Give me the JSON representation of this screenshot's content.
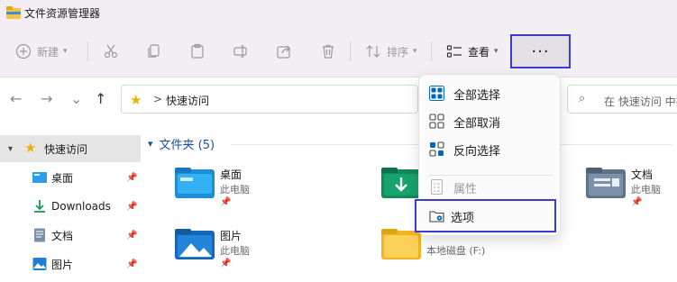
{
  "window": {
    "title": "文件资源管理器"
  },
  "toolbar": {
    "new_label": "新建",
    "sort_label": "排序",
    "view_label": "查看",
    "more_label": "···",
    "icons": {
      "new": "plus-circle-icon",
      "cut": "scissors-icon",
      "copy": "copy-icon",
      "paste": "clipboard-icon",
      "rename": "rename-icon",
      "share": "share-icon",
      "delete": "trash-icon",
      "sort": "sort-arrows-icon",
      "view": "view-list-icon"
    }
  },
  "address": {
    "crumb": "快速访问",
    "separator": ">"
  },
  "search": {
    "placeholder": "在 快速访问 中搜"
  },
  "sidebar": {
    "items": [
      {
        "label": "快速访问",
        "icon": "star-icon"
      },
      {
        "label": "桌面",
        "icon": "desktop-icon"
      },
      {
        "label": "Downloads",
        "icon": "download-icon"
      },
      {
        "label": "文档",
        "icon": "document-icon"
      },
      {
        "label": "图片",
        "icon": "picture-icon"
      }
    ]
  },
  "main": {
    "section_title": "文件夹 (5)",
    "folders": [
      {
        "name": "桌面",
        "location": "此电脑",
        "icon": "desktop-folder-icon"
      },
      {
        "name": "",
        "location": "",
        "icon": "download-folder-icon"
      },
      {
        "name": "文档",
        "location": "此电脑",
        "icon": "document-folder-icon"
      },
      {
        "name": "图片",
        "location": "此电脑",
        "icon": "picture-folder-icon"
      },
      {
        "name": "",
        "location": "本地磁盘 (F:)",
        "icon": "folder-icon"
      }
    ]
  },
  "menu": {
    "items": [
      {
        "label": "全部选择",
        "icon": "select-all-icon",
        "enabled": true
      },
      {
        "label": "全部取消",
        "icon": "select-none-icon",
        "enabled": true
      },
      {
        "label": "反向选择",
        "icon": "invert-selection-icon",
        "enabled": true
      },
      {
        "label": "属性",
        "icon": "properties-icon",
        "enabled": false
      },
      {
        "label": "选项",
        "icon": "options-icon",
        "enabled": true
      }
    ]
  },
  "colors": {
    "highlight_border": "#3b3bd0",
    "accent": "#0067c0",
    "section_header": "#1d4f99"
  }
}
